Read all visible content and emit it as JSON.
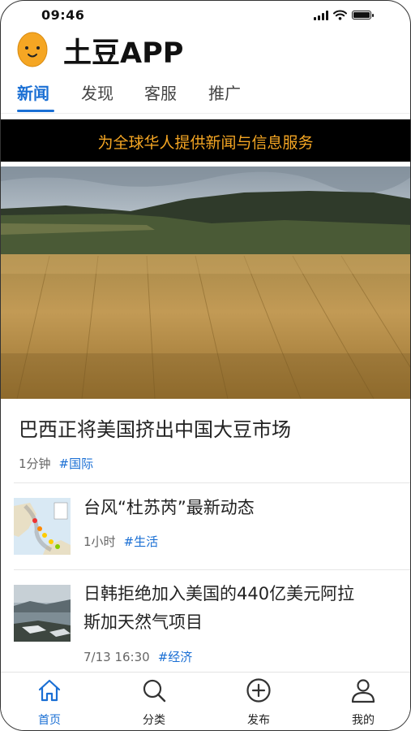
{
  "status_bar": {
    "time": "09:46"
  },
  "header": {
    "app_title": "土豆APP"
  },
  "tabs": [
    {
      "label": "新闻",
      "active": true
    },
    {
      "label": "发现"
    },
    {
      "label": "客服"
    },
    {
      "label": "推广"
    }
  ],
  "banner": {
    "text": "为全球华人提供新闻与信息服务"
  },
  "hero_article": {
    "title": "巴西正将美国挤出中国大豆市场",
    "time": "1分钟",
    "tag": "#国际"
  },
  "articles": [
    {
      "title": "台风“杜苏芮”最新动态",
      "time": "1小时",
      "tag": "#生活"
    },
    {
      "title_line1": "日韩拒绝加入美国的440亿美元阿拉",
      "title_line2": "斯加天然气项目",
      "time": "7/13 16:30",
      "tag": "#经济"
    }
  ],
  "bottom_nav": [
    {
      "label": "首页",
      "icon": "home-icon",
      "active": true
    },
    {
      "label": "分类",
      "icon": "search-icon"
    },
    {
      "label": "发布",
      "icon": "plus-circle-icon"
    },
    {
      "label": "我的",
      "icon": "user-icon"
    }
  ],
  "colors": {
    "accent": "#1a6fd4",
    "banner_text": "#f5a623",
    "banner_bg": "#000000"
  }
}
